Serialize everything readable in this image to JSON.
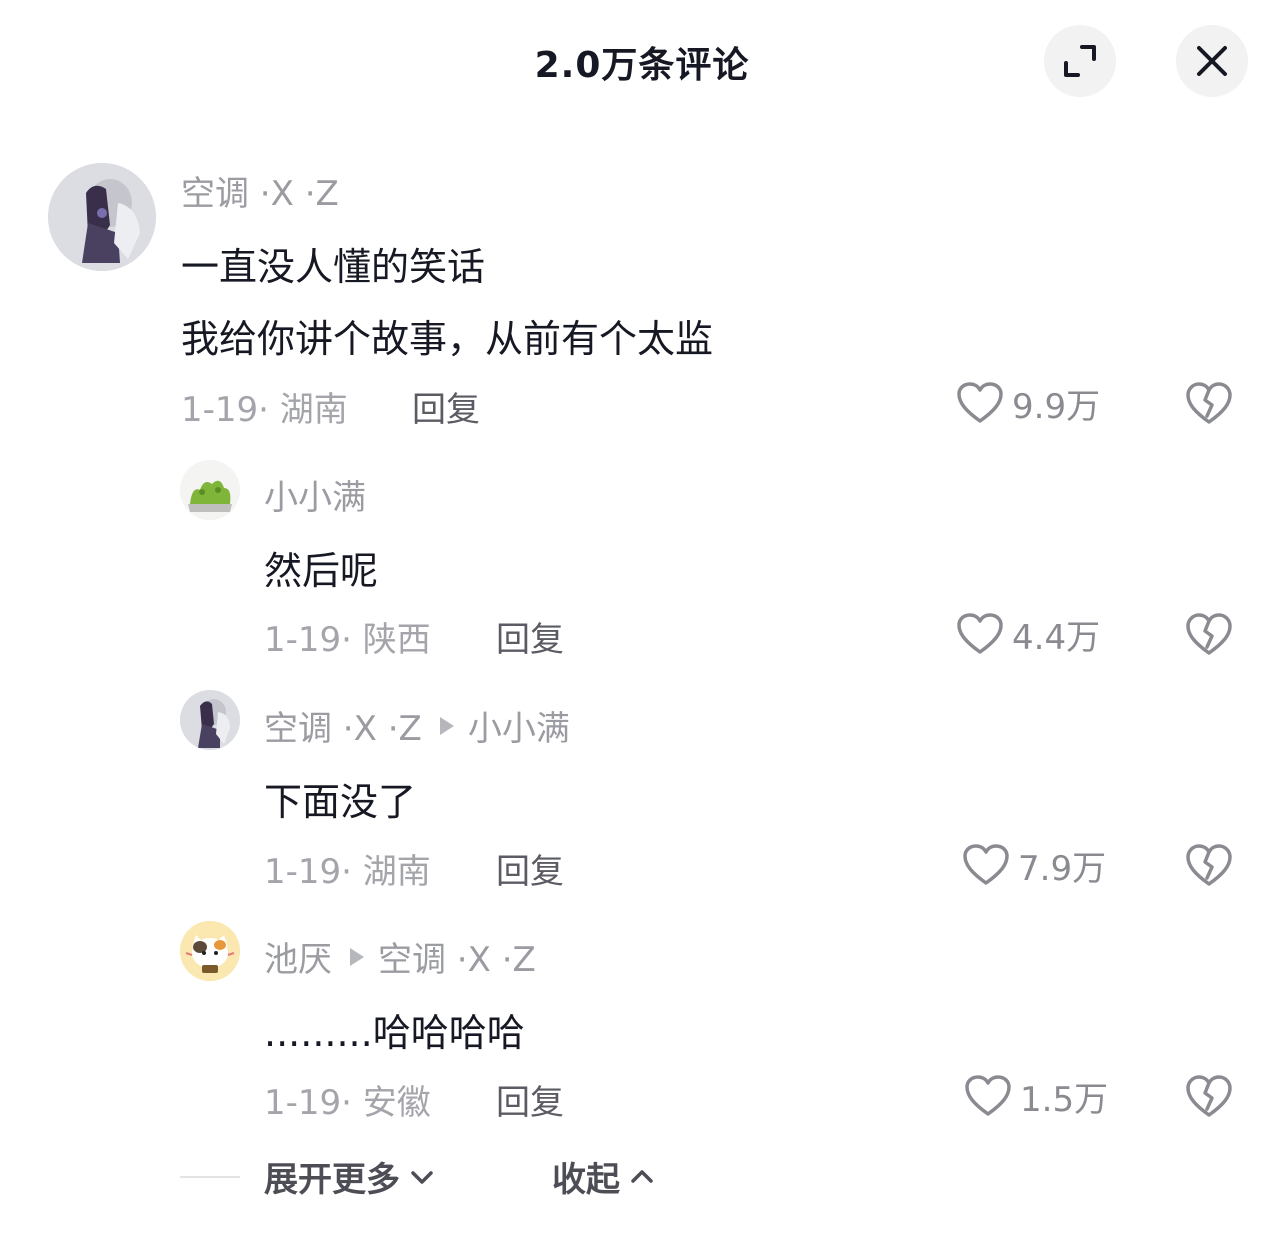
{
  "header": {
    "title": "2.0万条评论",
    "expand_icon": "expand-icon",
    "close_icon": "close-icon"
  },
  "comments": [
    {
      "username": "空调 ·X ·Z",
      "lines": [
        "一直没人懂的笑话",
        "我给你讲个故事，从前有个太监"
      ],
      "meta": "1-19· 湖南",
      "reply_label": "回复",
      "likes": "9.9万"
    },
    {
      "username": "小小满",
      "text": "然后呢",
      "meta": "1-19· 陕西",
      "reply_label": "回复",
      "likes": "4.4万"
    },
    {
      "username": "空调 ·X ·Z",
      "reply_to": "小小满",
      "text": "下面没了",
      "meta": "1-19· 湖南",
      "reply_label": "回复",
      "likes": "7.9万"
    },
    {
      "username": "池厌",
      "reply_to": "空调 ·X ·Z",
      "text": ".........哈哈哈哈",
      "meta": "1-19· 安徽",
      "reply_label": "回复",
      "likes": "1.5万"
    }
  ],
  "footer": {
    "expand_more": "展开更多",
    "collapse": "收起"
  },
  "colors": {
    "text_primary": "#161823",
    "text_secondary": "#9b9ca2",
    "button_bg": "#f2f2f3"
  }
}
